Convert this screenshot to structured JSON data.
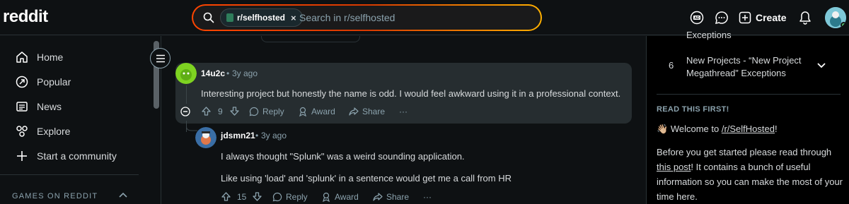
{
  "header": {
    "logo": "reddit",
    "search": {
      "chip_label": "r/selfhosted",
      "chip_close": "×",
      "placeholder": "Search in r/selfhosted"
    },
    "create_label": "Create"
  },
  "sidebar": {
    "items": [
      {
        "label": "Home",
        "icon": "home-icon"
      },
      {
        "label": "Popular",
        "icon": "popular-icon"
      },
      {
        "label": "News",
        "icon": "news-icon"
      },
      {
        "label": "Explore",
        "icon": "explore-icon"
      },
      {
        "label": "Start a community",
        "icon": "plus-icon"
      }
    ],
    "games_label": "GAMES ON REDDIT"
  },
  "comments": [
    {
      "author": "14u2c",
      "sep": "•",
      "age": "3y ago",
      "body": "Interesting project but honestly the name is odd. I would feel awkward using it in a professional context.",
      "votes": "9",
      "reply": "Reply",
      "award": "Award",
      "share": "Share",
      "more": "···"
    },
    {
      "author": "jdsmn21",
      "sep": "•",
      "age": "3y ago",
      "body_lines": [
        "I always thought \"Splunk\" was a weird sounding application.",
        "Like using 'load' and 'splunk' in a sentence would get me a call from HR"
      ],
      "votes": "15",
      "reply": "Reply",
      "award": "Award",
      "share": "Share",
      "more": "···"
    }
  ],
  "right_sidebar": {
    "prev_rule_fragment": "Exceptions",
    "rule": {
      "number": "6",
      "text": "New Projects - “New Project Megathread” Exceptions"
    },
    "read_first_title": "READ THIS FIRST!",
    "welcome_emoji": "👋🏼",
    "welcome_prefix": "Welcome to ",
    "welcome_link": "/r/SelfHosted",
    "welcome_suffix": "!",
    "before_prefix": "Before you get started please read through ",
    "before_link": "this post",
    "before_suffix": "! It contains a bunch of useful information so you can make the most of your time here."
  },
  "colors": {
    "background": "#0e1113",
    "highlight": "#262d30",
    "accent_gradient": [
      "#ff4500",
      "#ffb000"
    ]
  }
}
